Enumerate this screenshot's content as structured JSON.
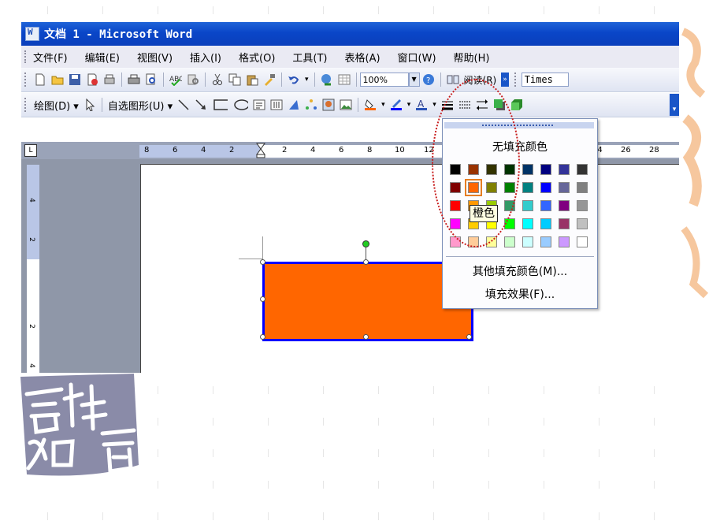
{
  "window": {
    "title": "文档 1 - Microsoft Word"
  },
  "menu": [
    "文件(F)",
    "编辑(E)",
    "视图(V)",
    "插入(I)",
    "格式(O)",
    "工具(T)",
    "表格(A)",
    "窗口(W)",
    "帮助(H)"
  ],
  "standard_toolbar": {
    "zoom": "100%",
    "reading_button": "阅读(R)",
    "font": "Times"
  },
  "drawing_toolbar": {
    "draw_button": "绘图(D)",
    "autoshapes_button": "自选图形(U)"
  },
  "ruler": {
    "horizontal_labels": [
      "8",
      "6",
      "4",
      "2",
      "2",
      "4",
      "6",
      "8",
      "10",
      "12",
      "24",
      "26",
      "28"
    ],
    "vertical_labels": [
      "4",
      "2",
      "2",
      "4"
    ]
  },
  "shape": {
    "fill_color": "#ff6600",
    "line_color": "#0000ff"
  },
  "fill_popup": {
    "no_fill": "无填充颜色",
    "tooltip": "橙色",
    "more_colors": "其他填充颜色(M)...",
    "fill_effects": "填充效果(F)...",
    "selected_index": 9,
    "colors": [
      "#000000",
      "#993300",
      "#333300",
      "#003300",
      "#003366",
      "#000080",
      "#333399",
      "#333333",
      "#800000",
      "#ff6600",
      "#808000",
      "#008000",
      "#008080",
      "#0000ff",
      "#666699",
      "#808080",
      "#ff0000",
      "#ff9900",
      "#99cc00",
      "#339966",
      "#33cccc",
      "#3366ff",
      "#800080",
      "#969696",
      "#ff00ff",
      "#ffcc00",
      "#ffff00",
      "#00ff00",
      "#00ffff",
      "#00ccff",
      "#993366",
      "#c0c0c0",
      "#ff99cc",
      "#ffcc99",
      "#ffff99",
      "#ccffcc",
      "#ccffff",
      "#99ccff",
      "#cc99ff",
      "#ffffff"
    ]
  },
  "decor": {
    "seal_text": "吉祥如意"
  }
}
